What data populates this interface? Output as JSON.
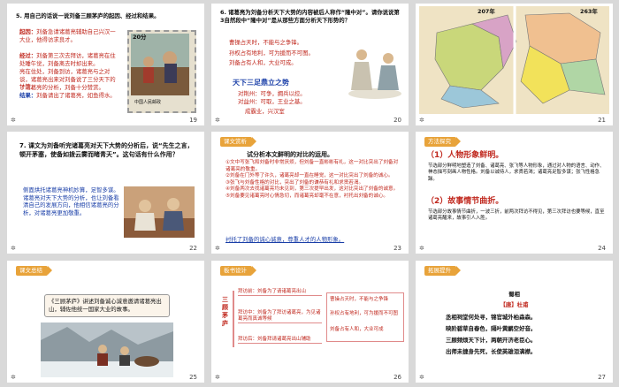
{
  "slides": [
    {
      "num": "19",
      "title": "5. 用自己的话说一说刘备三顾茅庐的起因、经过和结果。",
      "cause_label": "起因：",
      "cause": "刘备急请诸葛亮辅助自己兴汉一大业，他得访求良才。",
      "process_label": "经过：",
      "process": "刘备第三次去拜访，诸葛亮在住处睡午觉，刘备离去时却出来。",
      "process2": "亮在住处，刘备到访，诸葛亮与之对谈，诸葛亮出来对刘备说了三分天下的计策。",
      "process3": "了诸葛亮的分析，刘备十分赞赏。",
      "result_label": "结果：",
      "result": "刘备请出了诸葛亮，如鱼得水。",
      "stamp_value": "20分",
      "stamp_caption": "中国人民邮政"
    },
    {
      "num": "20",
      "title": "6. 诸葛亮为刘备分析天下大势的内容被后人称作“隆中对”。请你说说第3自然段中“隆中对”是从那些方面分析天下形势的？",
      "points": [
        "曹操占天时，不能与之争锋。",
        "孙权占有地利，可为援而不可图。",
        "刘备占有人和，大业可成。"
      ],
      "sub_title": "天下三足鼎立之势",
      "sub_items": [
        "对荆州：可争，拥兵以控。",
        "对益州：可取，王业之基。",
        "成霸业，兴汉室"
      ]
    },
    {
      "num": "21",
      "map_labels": [
        "207年",
        "263年"
      ]
    },
    {
      "num": "22",
      "title": "7. 课文为刘备听完诸葛亮对天下大势的分析后，说“先生之言，顿开茅塞，使备如拨云雾而睹青天”。这句话有什么作用？",
      "answer": "侧面烘托诸葛亮神机妙算，足智多谋。诸葛亮对天下大势的分析，也让刘备看清自己的发展方向，他相信诸葛亮的分析，对诸葛亮更加敬重。"
    },
    {
      "num": "23",
      "tag": "课文赏析",
      "title": "试分析本文鲜明的对比的运用。",
      "lines": [
        "①文中写张飞和刘备时非常厌烦，但刘备一直彬彬有礼，这一对比突出了刘备对诸葛亮的敬重。",
        "②刘备在门外等了许久，诸葛亮却一直在睡觉，这一对比突出了刘备的诚心。",
        "③张飞与刘备性格的对比，突出了刘备的谦恭有礼和求贤若渴。",
        "④刘备两次去找诸葛亮均未见到，第三次提早出发，这对比突出了刘备的诚意。",
        "⑤刘备要见诸葛亮时心情急切，而诸葛亮却毫不在意，衬托出刘备的诚心。"
      ],
      "footer": "衬托了刘备的诚心诚意，尊重人才的人物形象。"
    },
    {
      "num": "24",
      "tag": "方法探究",
      "h1": "（1）人物形象鲜明。",
      "p1": "节选部分鲜明地塑造了刘备、诸葛亮、张飞等人物形象，通过对人物的语言、动作、神态描写刻画人物性格。刘备以诚待人，求贤若渴；诸葛亮足智多谋；张飞性格急躁。",
      "h2": "（2）故事情节曲折。",
      "p2": "节选部分故事情节曲折，一波三折，前两次拜访不得见，第三次拜访也要等候，直至诸葛亮醒来，故事引人入胜。"
    },
    {
      "num": "25",
      "tag": "课文总结",
      "summary": "《三顾茅庐》讲述刘备诚心诚意邀请诸葛亮出山，辅佐他统一国家大业的故事。"
    },
    {
      "num": "26",
      "tag": "板书设计",
      "side": "三顾茅庐",
      "left": [
        "拜访前：刘备为了请诸葛亮出山",
        "拜访中：刘备为了拜访诸葛亮，为见诸葛亮而真诚等候",
        "拜访后：刘备拜请诸葛亮出山辅助"
      ],
      "right": [
        "曹操占天时，不能与之争锋",
        "孙权占有地利，可为援而不可图",
        "刘备占有人和，大业可成"
      ]
    },
    {
      "num": "27",
      "tag": "拓展提升",
      "poem_title": "蜀相",
      "author": "【唐】杜甫",
      "poem": [
        "丞相祠堂何处寻，锦官城外柏森森。",
        "映阶碧草自春色，隔叶黄鹂空好音。",
        "三顾频烦天下计，两朝开济老臣心。",
        "出师未捷身先死，长使英雄泪满襟。"
      ]
    }
  ],
  "colors": {
    "accent": "#e8a33a",
    "red": "#c0281e",
    "blue": "#1a3fa8",
    "selection": "#f0a040"
  }
}
